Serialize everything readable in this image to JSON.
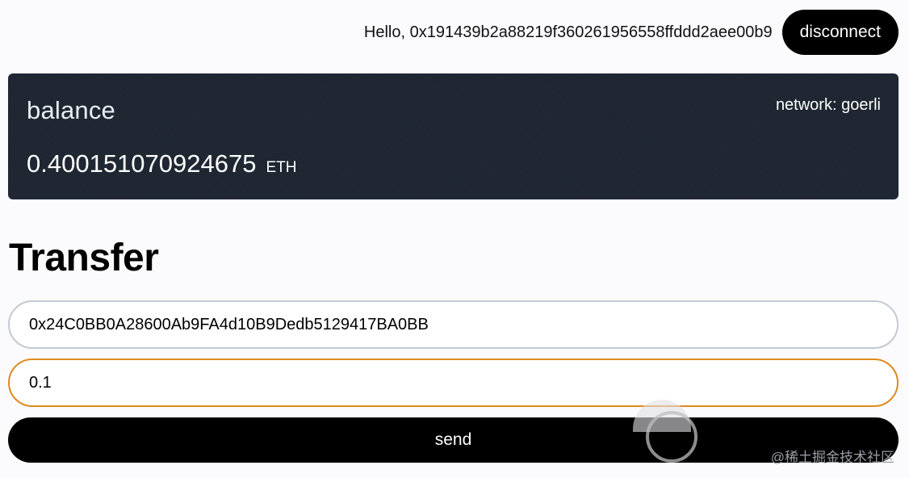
{
  "header": {
    "greeting": "Hello, 0x191439b2a88219f360261956558ffddd2aee00b9",
    "disconnect_label": "disconnect"
  },
  "balance_card": {
    "label": "balance",
    "network": "network: goerli",
    "amount": "0.400151070924675",
    "unit": "ETH"
  },
  "transfer": {
    "title": "Transfer",
    "address_value": "0x24C0BB0A28600Ab9FA4d10B9Dedb5129417BA0BB",
    "amount_value": "0.1",
    "send_label": "send"
  },
  "watermark": "@稀土掘金技术社区",
  "colors": {
    "card_bg": "#1f2733",
    "focus_border": "#de8a1e",
    "input_border": "#c3cad3",
    "button_bg": "#000000"
  }
}
